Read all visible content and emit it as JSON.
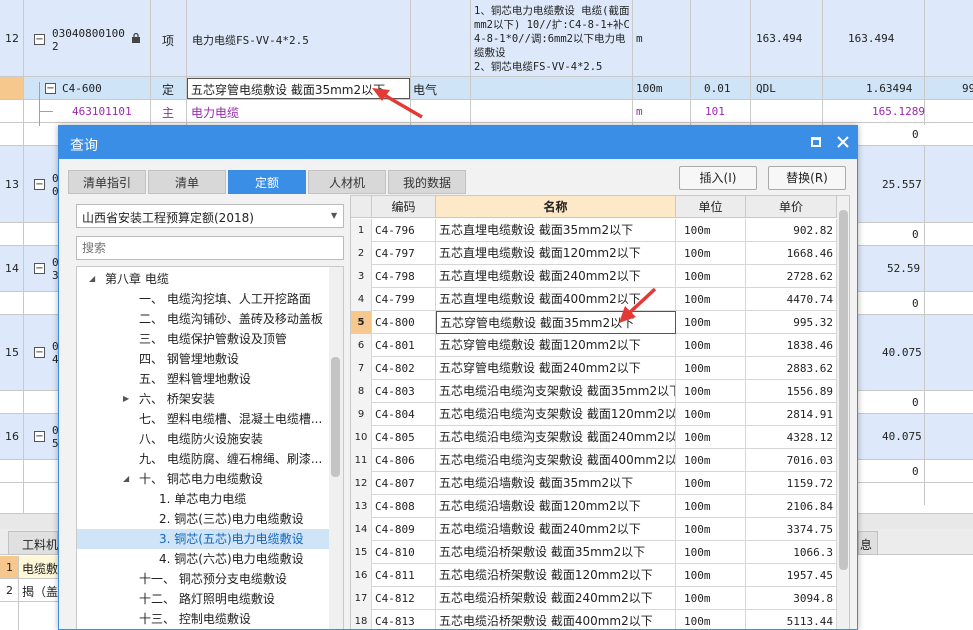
{
  "bg": {
    "row12": {
      "no": "12",
      "code_line1": "03040800100",
      "code_line2": "2",
      "type": "项",
      "name": "电力电缆FS-VV-4*2.5",
      "desc": "1、铜芯电力电缆敷设 电缆(截面mm2以下) 10//扩:C4-8-1+补C4-8-1*0//调:6mm2以下电力电缆敷设\n2、铜芯电缆FS-VV-4*2.5",
      "unit": "m",
      "qty": "163.494",
      "qty2": "163.494"
    },
    "row_c4600": {
      "code": "C4-600",
      "type": "定",
      "name": "五芯穿管电缆敷设 截面35mm2以下",
      "cat": "电气",
      "unit": "100m",
      "coef": "0.01",
      "expr": "QDL",
      "qty": "1.63494",
      "extra": "99"
    },
    "row_main": {
      "code": "463101101",
      "type": "主",
      "name": "电力电缆",
      "unit": "m",
      "coef": "101",
      "qty": "165.1289"
    },
    "row_blank": {
      "val": "0"
    },
    "row13": {
      "no": "13",
      "code": "0",
      "code2": "0",
      "qty": "25.557",
      "zero": "0"
    },
    "row14": {
      "no": "14",
      "code": "0",
      "code2": "3",
      "qty": "52.59",
      "zero": "0"
    },
    "row15": {
      "no": "15",
      "code": "0",
      "code2": "4",
      "qty": "40.075",
      "zero": "0"
    },
    "row16": {
      "no": "16",
      "code": "0",
      "code2": "5",
      "qty": "40.075",
      "zero": "0"
    },
    "bottom_tab": "工料机",
    "bottom_right_tab": "息",
    "bottom_rows": [
      {
        "no": "1",
        "text": "电缆敷"
      },
      {
        "no": "2",
        "text": "揭（盖"
      }
    ]
  },
  "dialog": {
    "title": "查询",
    "tabs": [
      "清单指引",
      "清单",
      "定额",
      "人材机",
      "我的数据"
    ],
    "active_tab": 2,
    "insert_btn": "插入(I)",
    "replace_btn": "替换(R)",
    "quota_select": "山西省安装工程预算定额(2018)",
    "search_placeholder": "搜索",
    "tree": [
      {
        "label": "第八章 电缆",
        "level": 0,
        "arrow": "▲"
      },
      {
        "label": "一、 电缆沟挖填、人工开挖路面",
        "level": 1
      },
      {
        "label": "二、 电缆沟铺砂、盖砖及移动盖板",
        "level": 1
      },
      {
        "label": "三、 电缆保护管敷设及顶管",
        "level": 1
      },
      {
        "label": "四、 钢管埋地敷设",
        "level": 1
      },
      {
        "label": "五、 塑料管埋地敷设",
        "level": 1
      },
      {
        "label": "六、 桥架安装",
        "level": 1,
        "arrow": "▶"
      },
      {
        "label": "七、 塑料电缆槽、混凝土电缆槽...",
        "level": 1
      },
      {
        "label": "八、 电缆防火设施安装",
        "level": 1
      },
      {
        "label": "九、 电缆防腐、缠石棉绳、刷漆...",
        "level": 1
      },
      {
        "label": "十、 铜芯电力电缆敷设",
        "level": 1,
        "arrow": "▲"
      },
      {
        "label": "1. 单芯电力电缆",
        "level": 2
      },
      {
        "label": "2. 铜芯(三芯)电力电缆敷设",
        "level": 2
      },
      {
        "label": "3. 铜芯(五芯)电力电缆敷设",
        "level": 2,
        "selected": true
      },
      {
        "label": "4. 铜芯(六芯)电力电缆敷设",
        "level": 2
      },
      {
        "label": "十一、 铜芯预分支电缆敷设",
        "level": 1
      },
      {
        "label": "十二、 路灯照明电缆敷设",
        "level": 1
      },
      {
        "label": "十三、 控制电缆敷设",
        "level": 1
      }
    ],
    "grid": {
      "headers": [
        "",
        "编码",
        "名称",
        "单位",
        "单价"
      ],
      "selected_index": 4,
      "rows": [
        {
          "no": "1",
          "code": "C4-796",
          "name": "五芯直埋电缆敷设 截面35mm2以下",
          "unit": "100m",
          "price": "902.82"
        },
        {
          "no": "2",
          "code": "C4-797",
          "name": "五芯直埋电缆敷设 截面120mm2以下",
          "unit": "100m",
          "price": "1668.46"
        },
        {
          "no": "3",
          "code": "C4-798",
          "name": "五芯直埋电缆敷设 截面240mm2以下",
          "unit": "100m",
          "price": "2728.62"
        },
        {
          "no": "4",
          "code": "C4-799",
          "name": "五芯直埋电缆敷设 截面400mm2以下",
          "unit": "100m",
          "price": "4470.74"
        },
        {
          "no": "5",
          "code": "C4-800",
          "name": "五芯穿管电缆敷设 截面35mm2以下",
          "unit": "100m",
          "price": "995.32"
        },
        {
          "no": "6",
          "code": "C4-801",
          "name": "五芯穿管电缆敷设 截面120mm2以下",
          "unit": "100m",
          "price": "1838.46"
        },
        {
          "no": "7",
          "code": "C4-802",
          "name": "五芯穿管电缆敷设 截面240mm2以下",
          "unit": "100m",
          "price": "2883.62"
        },
        {
          "no": "8",
          "code": "C4-803",
          "name": "五芯电缆沿电缆沟支架敷设 截面35mm2以下",
          "unit": "100m",
          "price": "1556.89"
        },
        {
          "no": "9",
          "code": "C4-804",
          "name": "五芯电缆沿电缆沟支架敷设 截面120mm2以下",
          "unit": "100m",
          "price": "2814.91"
        },
        {
          "no": "10",
          "code": "C4-805",
          "name": "五芯电缆沿电缆沟支架敷设 截面240mm2以下",
          "unit": "100m",
          "price": "4328.12"
        },
        {
          "no": "11",
          "code": "C4-806",
          "name": "五芯电缆沿电缆沟支架敷设 截面400mm2以下",
          "unit": "100m",
          "price": "7016.03"
        },
        {
          "no": "12",
          "code": "C4-807",
          "name": "五芯电缆沿墙敷设 截面35mm2以下",
          "unit": "100m",
          "price": "1159.72"
        },
        {
          "no": "13",
          "code": "C4-808",
          "name": "五芯电缆沿墙敷设 截面120mm2以下",
          "unit": "100m",
          "price": "2106.84"
        },
        {
          "no": "14",
          "code": "C4-809",
          "name": "五芯电缆沿墙敷设 截面240mm2以下",
          "unit": "100m",
          "price": "3374.75"
        },
        {
          "no": "15",
          "code": "C4-810",
          "name": "五芯电缆沿桥架敷设 截面35mm2以下",
          "unit": "100m",
          "price": "1066.3"
        },
        {
          "no": "16",
          "code": "C4-811",
          "name": "五芯电缆沿桥架敷设 截面120mm2以下",
          "unit": "100m",
          "price": "1957.45"
        },
        {
          "no": "17",
          "code": "C4-812",
          "name": "五芯电缆沿桥架敷设 截面240mm2以下",
          "unit": "100m",
          "price": "3094.8"
        },
        {
          "no": "18",
          "code": "C4-813",
          "name": "五芯电缆沿桥架敷设 截面400mm2以下",
          "unit": "100m",
          "price": "5113.44"
        }
      ]
    }
  },
  "colors": {
    "accent": "#3a8ee6",
    "arrow": "#e53935",
    "purple": "#9c27b0",
    "selected_row": "#cfe4f7",
    "header_orange": "#fde8c8"
  }
}
